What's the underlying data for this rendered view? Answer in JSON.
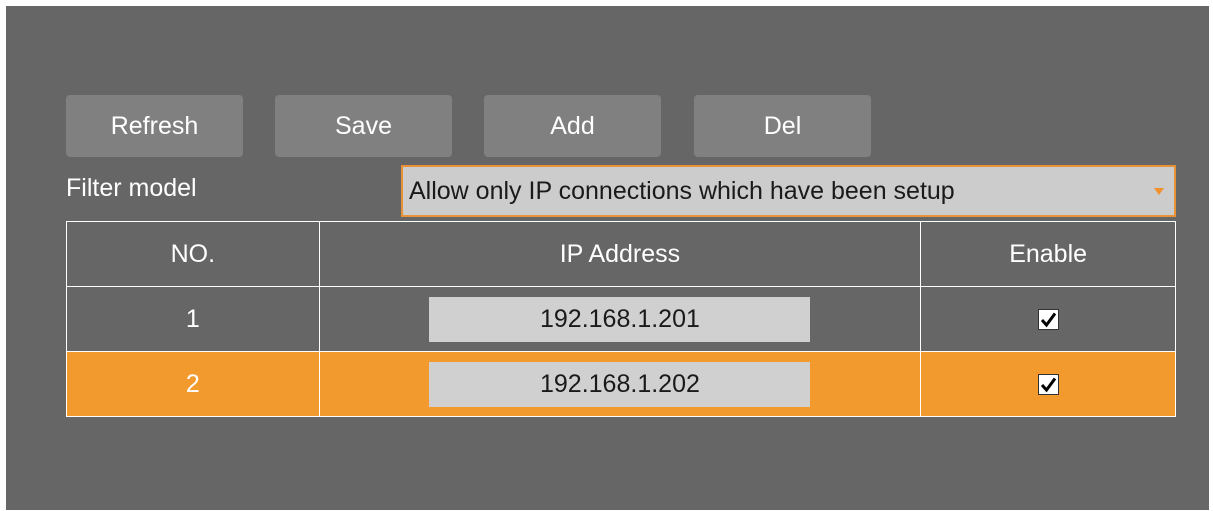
{
  "toolbar": {
    "refresh_label": "Refresh",
    "save_label": "Save",
    "add_label": "Add",
    "del_label": "Del"
  },
  "filter": {
    "label": "Filter model",
    "selected": "Allow only IP connections which have been setup"
  },
  "table": {
    "headers": [
      "NO.",
      "IP Address",
      "Enable"
    ],
    "rows": [
      {
        "no": "1",
        "ip": "192.168.1.201",
        "enabled": true
      },
      {
        "no": "2",
        "ip": "192.168.1.202",
        "enabled": true
      }
    ],
    "selected_row": "2"
  },
  "colors": {
    "panel_bg": "#666666",
    "button_bg": "#808080",
    "accent": "#f39a2e",
    "select_bg": "#cccccc"
  },
  "icons": {
    "dropdown": "chevron-down-icon",
    "checkbox": "checkmark-icon"
  }
}
